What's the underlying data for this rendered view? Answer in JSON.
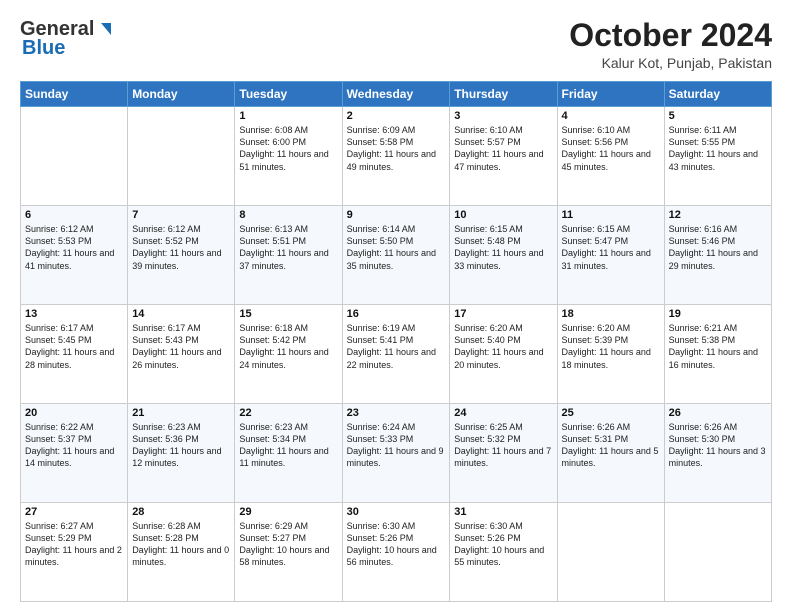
{
  "header": {
    "logo_general": "General",
    "logo_blue": "Blue",
    "title": "October 2024",
    "location": "Kalur Kot, Punjab, Pakistan"
  },
  "days_of_week": [
    "Sunday",
    "Monday",
    "Tuesday",
    "Wednesday",
    "Thursday",
    "Friday",
    "Saturday"
  ],
  "weeks": [
    [
      null,
      null,
      {
        "day": 1,
        "sunrise": "6:08 AM",
        "sunset": "6:00 PM",
        "daylight": "11 hours and 51 minutes."
      },
      {
        "day": 2,
        "sunrise": "6:09 AM",
        "sunset": "5:58 PM",
        "daylight": "11 hours and 49 minutes."
      },
      {
        "day": 3,
        "sunrise": "6:10 AM",
        "sunset": "5:57 PM",
        "daylight": "11 hours and 47 minutes."
      },
      {
        "day": 4,
        "sunrise": "6:10 AM",
        "sunset": "5:56 PM",
        "daylight": "11 hours and 45 minutes."
      },
      {
        "day": 5,
        "sunrise": "6:11 AM",
        "sunset": "5:55 PM",
        "daylight": "11 hours and 43 minutes."
      }
    ],
    [
      {
        "day": 6,
        "sunrise": "6:12 AM",
        "sunset": "5:53 PM",
        "daylight": "11 hours and 41 minutes."
      },
      {
        "day": 7,
        "sunrise": "6:12 AM",
        "sunset": "5:52 PM",
        "daylight": "11 hours and 39 minutes."
      },
      {
        "day": 8,
        "sunrise": "6:13 AM",
        "sunset": "5:51 PM",
        "daylight": "11 hours and 37 minutes."
      },
      {
        "day": 9,
        "sunrise": "6:14 AM",
        "sunset": "5:50 PM",
        "daylight": "11 hours and 35 minutes."
      },
      {
        "day": 10,
        "sunrise": "6:15 AM",
        "sunset": "5:48 PM",
        "daylight": "11 hours and 33 minutes."
      },
      {
        "day": 11,
        "sunrise": "6:15 AM",
        "sunset": "5:47 PM",
        "daylight": "11 hours and 31 minutes."
      },
      {
        "day": 12,
        "sunrise": "6:16 AM",
        "sunset": "5:46 PM",
        "daylight": "11 hours and 29 minutes."
      }
    ],
    [
      {
        "day": 13,
        "sunrise": "6:17 AM",
        "sunset": "5:45 PM",
        "daylight": "11 hours and 28 minutes."
      },
      {
        "day": 14,
        "sunrise": "6:17 AM",
        "sunset": "5:43 PM",
        "daylight": "11 hours and 26 minutes."
      },
      {
        "day": 15,
        "sunrise": "6:18 AM",
        "sunset": "5:42 PM",
        "daylight": "11 hours and 24 minutes."
      },
      {
        "day": 16,
        "sunrise": "6:19 AM",
        "sunset": "5:41 PM",
        "daylight": "11 hours and 22 minutes."
      },
      {
        "day": 17,
        "sunrise": "6:20 AM",
        "sunset": "5:40 PM",
        "daylight": "11 hours and 20 minutes."
      },
      {
        "day": 18,
        "sunrise": "6:20 AM",
        "sunset": "5:39 PM",
        "daylight": "11 hours and 18 minutes."
      },
      {
        "day": 19,
        "sunrise": "6:21 AM",
        "sunset": "5:38 PM",
        "daylight": "11 hours and 16 minutes."
      }
    ],
    [
      {
        "day": 20,
        "sunrise": "6:22 AM",
        "sunset": "5:37 PM",
        "daylight": "11 hours and 14 minutes."
      },
      {
        "day": 21,
        "sunrise": "6:23 AM",
        "sunset": "5:36 PM",
        "daylight": "11 hours and 12 minutes."
      },
      {
        "day": 22,
        "sunrise": "6:23 AM",
        "sunset": "5:34 PM",
        "daylight": "11 hours and 11 minutes."
      },
      {
        "day": 23,
        "sunrise": "6:24 AM",
        "sunset": "5:33 PM",
        "daylight": "11 hours and 9 minutes."
      },
      {
        "day": 24,
        "sunrise": "6:25 AM",
        "sunset": "5:32 PM",
        "daylight": "11 hours and 7 minutes."
      },
      {
        "day": 25,
        "sunrise": "6:26 AM",
        "sunset": "5:31 PM",
        "daylight": "11 hours and 5 minutes."
      },
      {
        "day": 26,
        "sunrise": "6:26 AM",
        "sunset": "5:30 PM",
        "daylight": "11 hours and 3 minutes."
      }
    ],
    [
      {
        "day": 27,
        "sunrise": "6:27 AM",
        "sunset": "5:29 PM",
        "daylight": "11 hours and 2 minutes."
      },
      {
        "day": 28,
        "sunrise": "6:28 AM",
        "sunset": "5:28 PM",
        "daylight": "11 hours and 0 minutes."
      },
      {
        "day": 29,
        "sunrise": "6:29 AM",
        "sunset": "5:27 PM",
        "daylight": "10 hours and 58 minutes."
      },
      {
        "day": 30,
        "sunrise": "6:30 AM",
        "sunset": "5:26 PM",
        "daylight": "10 hours and 56 minutes."
      },
      {
        "day": 31,
        "sunrise": "6:30 AM",
        "sunset": "5:26 PM",
        "daylight": "10 hours and 55 minutes."
      },
      null,
      null
    ]
  ]
}
